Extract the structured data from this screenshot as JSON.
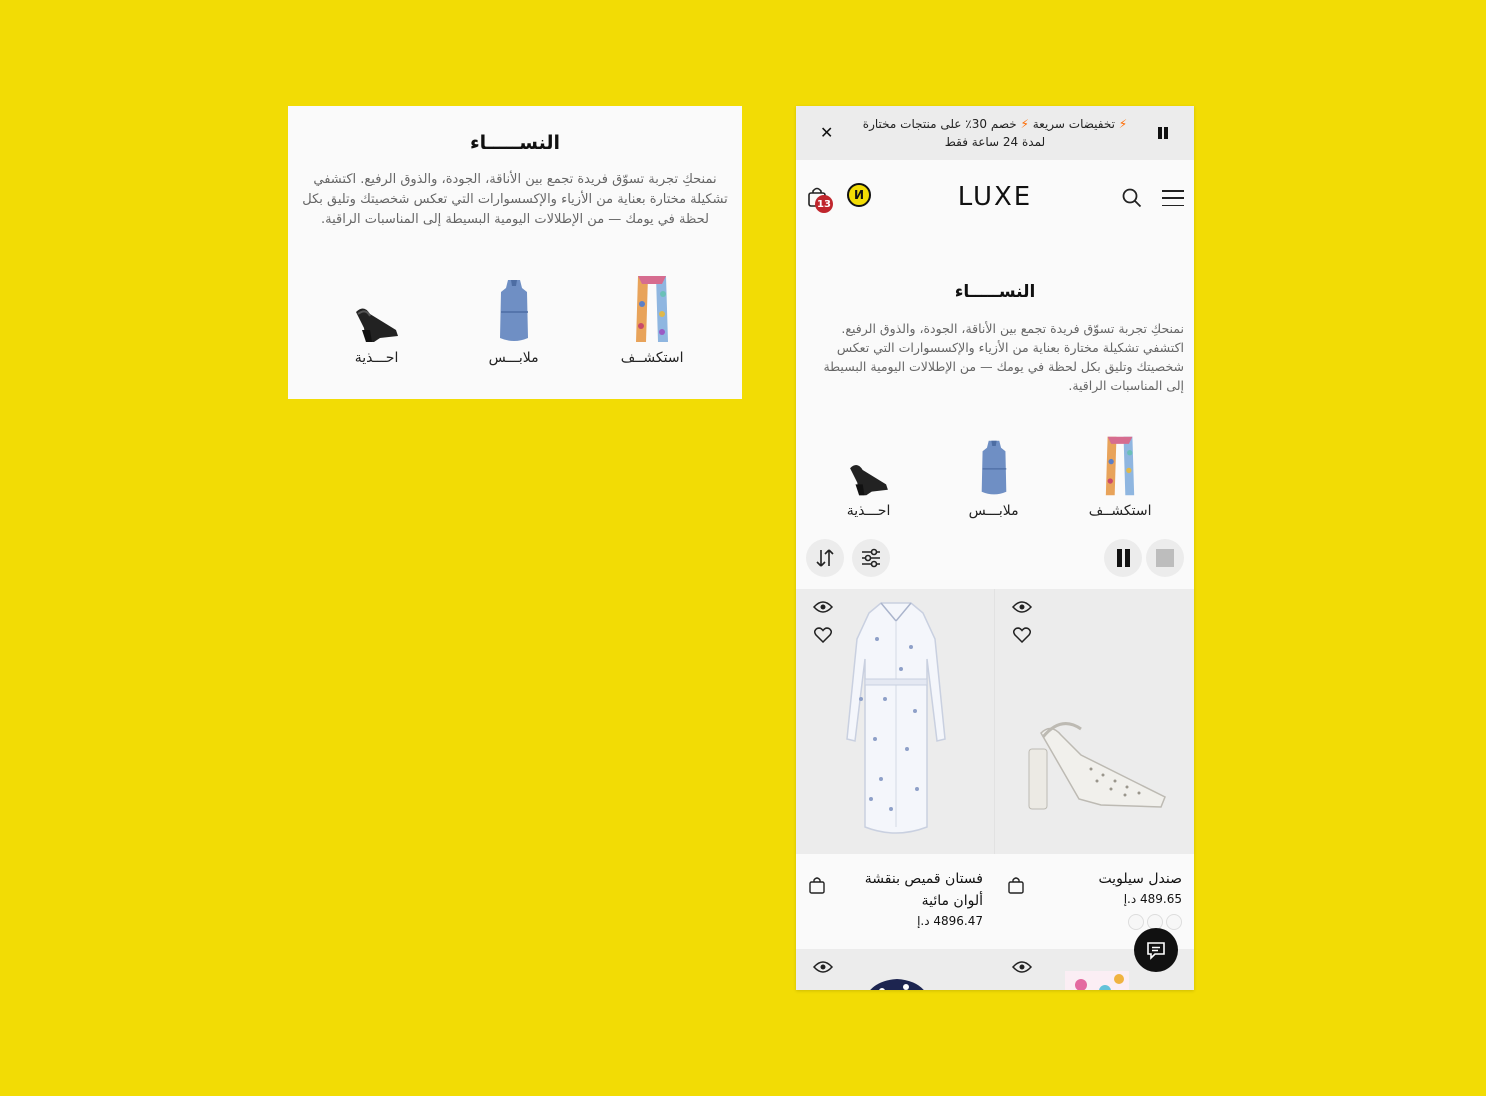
{
  "left_card": {
    "title": "النســـــاء",
    "description": "نمنحكِ تجربة تسوّق فريدة تجمع بين الأناقة، الجودة، والذوق الرفيع. اكتشفي تشكيلة مختارة بعناية من الأزياء والإكسسوارات التي تعكس شخصيتك وتليق بكل لحظة في يومك — من الإطلالات اليومية البسيطة إلى المناسبات الراقية.",
    "categories": [
      {
        "label": "استكشــف",
        "icon": "scarf-image"
      },
      {
        "label": "ملابـــس",
        "icon": "dress-image"
      },
      {
        "label": "احـــذية",
        "icon": "sandal-image"
      }
    ]
  },
  "phone": {
    "announcement": {
      "line1": "تخفيضات سريعة",
      "line1b": "خصم 30٪ على منتجات مختارة",
      "line2": "لمدة 24 ساعة فقط",
      "bolt": "⚡"
    },
    "header": {
      "logo": "LUXE",
      "cart_count": "13",
      "brand_mark": "И"
    },
    "title": "النســـــاء",
    "description": "نمنحكِ تجربة تسوّق فريدة تجمع بين الأناقة، الجودة، والذوق الرفيع. اكتشفي تشكيلة مختارة بعناية من الأزياء والإكسسوارات التي تعكس شخصيتك وتليق بكل لحظة في يومك — من الإطلالات اليومية البسيطة إلى المناسبات الراقية.",
    "categories": [
      {
        "label": "استكشــف"
      },
      {
        "label": "ملابـــس"
      },
      {
        "label": "احـــذية"
      }
    ],
    "products": [
      {
        "name": "صندل سيلويت",
        "price": "489.65 د.إ",
        "image": "white-sandal"
      },
      {
        "name": "فستان قميص بنقشة ألوان مائية",
        "price": "4896.47 د.إ",
        "image": "white-shirt-dress"
      }
    ]
  },
  "colors": {
    "background": "#f2dc05",
    "badge": "#c0262d",
    "bolt": "#ff6a00"
  }
}
